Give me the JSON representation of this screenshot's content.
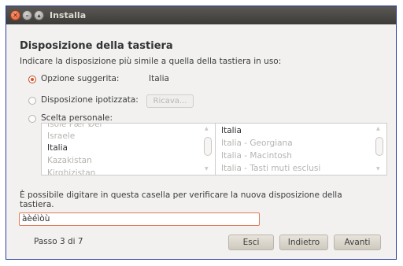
{
  "window": {
    "title": "Installa",
    "controls": [
      "close-icon",
      "minimize-icon",
      "maximize-icon"
    ]
  },
  "heading": "Disposizione della tastiera",
  "description": "Indicare la disposizione più simile a quella della tastiera in uso:",
  "options": {
    "suggested": {
      "label": "Opzione suggerita:",
      "value": "Italia",
      "selected": true
    },
    "guessed": {
      "label": "Disposizione ipotizzata:",
      "button": "Ricava..."
    },
    "custom": {
      "label": "Scelta personale:"
    }
  },
  "layouts_list": {
    "items": [
      "Isole Fær Øer",
      "Israele",
      "Italia",
      "Kazakistan",
      "Kirghizistan"
    ],
    "selected": "Italia"
  },
  "variants_list": {
    "items": [
      "Italia",
      "Italia - Georgiana",
      "Italia - Macintosh",
      "Italia - Tasti muti esclusi"
    ],
    "selected": "Italia"
  },
  "test_hint": "È possibile digitare in questa casella per verificare la nuova disposizione della tastiera.",
  "test_input": {
    "value": "àèéìòù"
  },
  "footer": {
    "step": "Passo 3 di 7",
    "quit": "Esci",
    "back": "Indietro",
    "forward": "Avanti"
  }
}
